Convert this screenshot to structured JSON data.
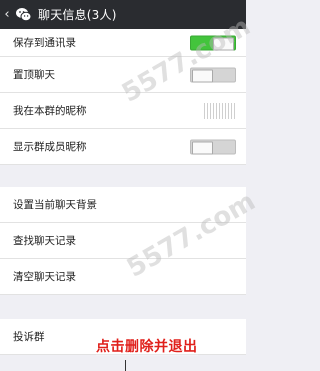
{
  "header": {
    "back_symbol": "‹",
    "title": "聊天信息(3人)"
  },
  "settings": [
    {
      "label": "保存到通讯录",
      "control": "toggle",
      "state": "on"
    },
    {
      "label": "置顶聊天",
      "control": "toggle",
      "state": "off"
    },
    {
      "label": "我在本群的昵称",
      "control": "text-blurred"
    },
    {
      "label": "显示群成员昵称",
      "control": "toggle",
      "state": "off"
    }
  ],
  "actions": [
    {
      "label": "设置当前聊天背景"
    },
    {
      "label": "查找聊天记录"
    },
    {
      "label": "清空聊天记录"
    }
  ],
  "more": [
    {
      "label": "投诉群"
    }
  ],
  "annotation": "点击删除并退出",
  "watermark": "5577.com",
  "colors": {
    "accent_green": "#43c43c",
    "topbar": "#2a2c30",
    "annotation_red": "#e0201b"
  }
}
